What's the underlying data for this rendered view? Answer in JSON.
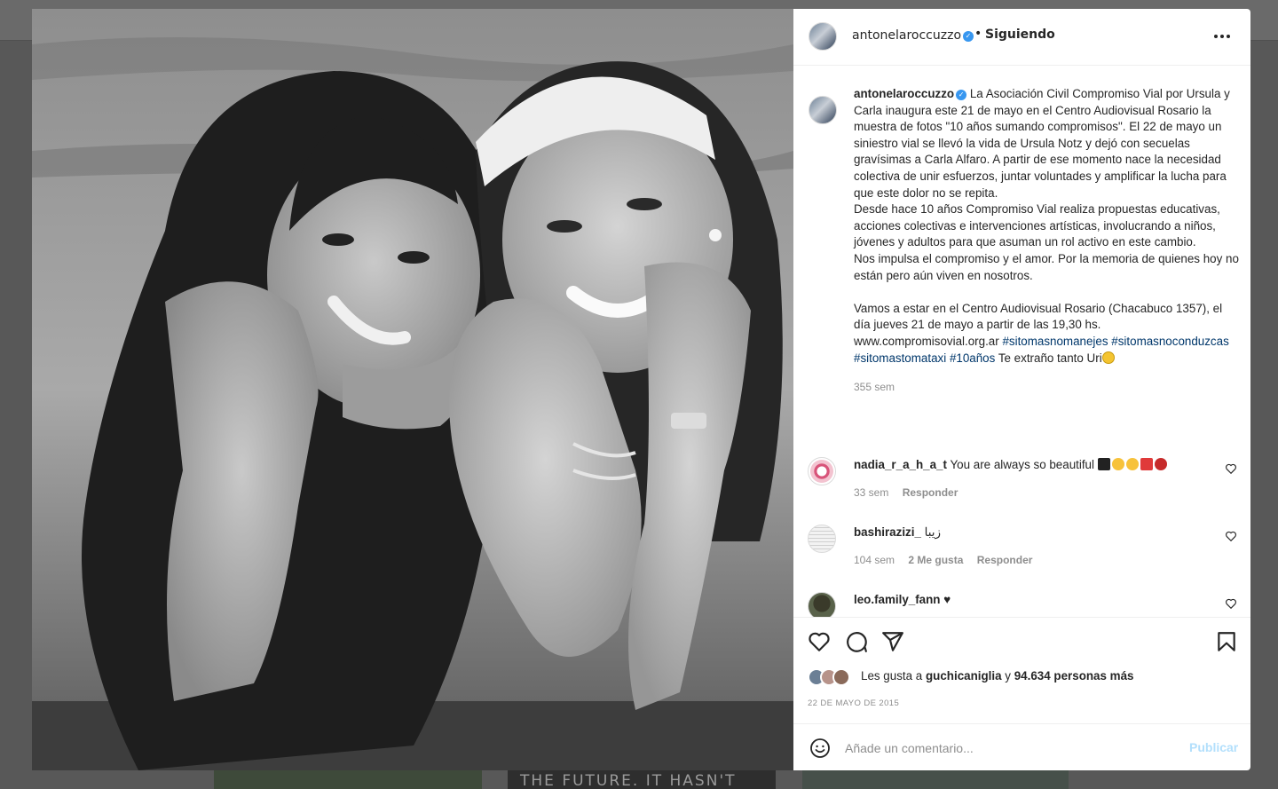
{
  "post": {
    "author": "antonelaroccuzzo",
    "verified_icon": "verified-badge-icon",
    "follow_status": "Siguiendo",
    "separator": "•",
    "more_icon": "more-options-icon"
  },
  "caption": {
    "author": "antonelaroccuzzo",
    "paragraph1": "La Asociación Civil Compromiso Vial por Ursula y Carla inaugura este 21 de mayo en el Centro Audiovisual Rosario la muestra de fotos \"10 años sumando compromisos\". El 22 de mayo un siniestro vial se llevó la vida de Ursula Notz y dejó con secuelas gravísimas a Carla Alfaro. A partir de ese momento nace la necesidad colectiva de unir esfuerzos, juntar voluntades y amplificar la lucha para que este dolor no se repita.",
    "paragraph2": "Desde hace 10 años Compromiso Vial realiza propuestas educativas, acciones colectivas e intervenciones artísticas, involucrando a niños, jóvenes y adultos para que asuman un rol activo en este cambio.",
    "paragraph3": "Nos impulsa el compromiso y el amor. Por la memoria de quienes hoy no están pero aún viven en nosotros.",
    "paragraph4": "Vamos a estar en el Centro Audiovisual Rosario (Chacabuco 1357), el día jueves 21 de mayo a partir de las 19,30 hs.",
    "website": "www.compromisovial.org.ar",
    "tags": [
      "#sitomasnomanejes",
      "#sitomasnoconduzcas",
      "#sitomastomataxi",
      "#10años"
    ],
    "closing": "Te extraño tanto Uri",
    "closing_emoji": "crying-face-emoji",
    "time": "355 sem"
  },
  "comments": [
    {
      "user": "nadia_r_a_h_a_t",
      "text": "You are always so beautiful",
      "emoji_note": "heart and face emojis",
      "time": "33 sem",
      "likes": "",
      "reply": "Responder"
    },
    {
      "user": "bashirazizi_",
      "text": "زیبا",
      "time": "104 sem",
      "likes": "2 Me gusta",
      "reply": "Responder"
    },
    {
      "user": "leo.family_fann",
      "text": "♥",
      "time": "",
      "likes": "",
      "reply": ""
    }
  ],
  "likes": {
    "prefix": "Les gusta a",
    "user": "guchicaniglia",
    "conjunction": "y",
    "others": "94.634 personas más"
  },
  "date": "22 DE MAYO DE 2015",
  "comment_box": {
    "placeholder": "Añade un comentario...",
    "publish": "Publicar"
  },
  "background": {
    "thumb_text": "THE FUTURE. IT HASN'T"
  },
  "colors": {
    "link": "#00376b",
    "verified": "#3897f0",
    "publish_disabled": "#b2dffc",
    "secondary_text": "#8e8e8e"
  }
}
